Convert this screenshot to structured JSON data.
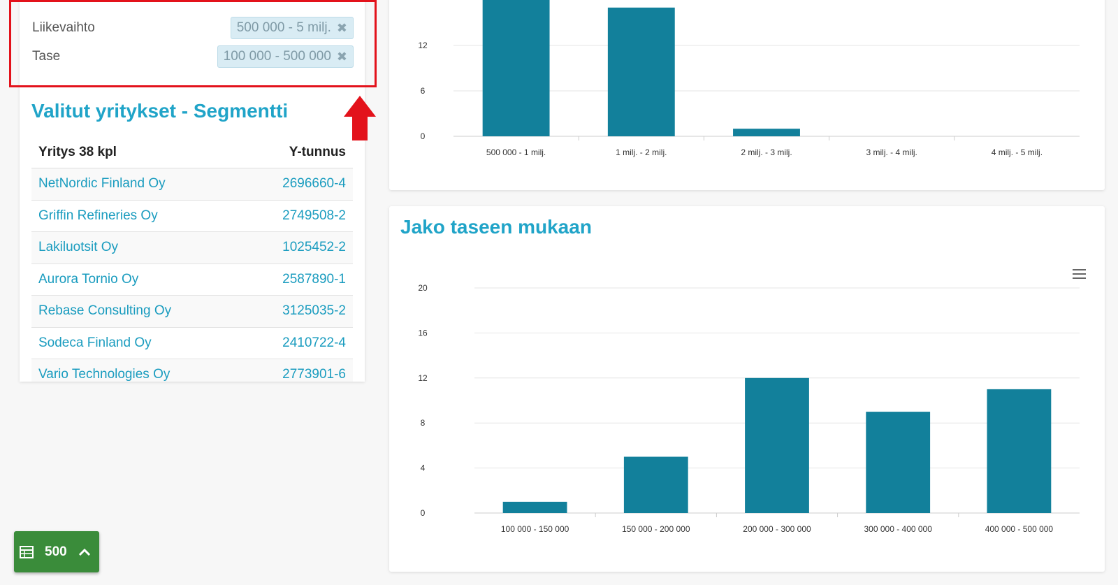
{
  "filters": {
    "items": [
      {
        "label": "Liikevaihto",
        "value": "500 000 - 5 milj."
      },
      {
        "label": "Tase",
        "value": "100 000 - 500 000"
      }
    ]
  },
  "section_title": "Valitut yritykset - Segmentti",
  "table": {
    "headers": {
      "company": "Yritys 38 kpl",
      "id": "Y-tunnus"
    },
    "rows": [
      {
        "name": "NetNordic Finland Oy",
        "id": "2696660-4"
      },
      {
        "name": "Griffin Refineries Oy",
        "id": "2749508-2"
      },
      {
        "name": "Lakiluotsit Oy",
        "id": "1025452-2"
      },
      {
        "name": "Aurora Tornio Oy",
        "id": "2587890-1"
      },
      {
        "name": "Rebase Consulting Oy",
        "id": "3125035-2"
      },
      {
        "name": "Sodeca Finland Oy",
        "id": "2410722-4"
      },
      {
        "name": "Vario Technologies Oy",
        "id": "2773901-6"
      }
    ]
  },
  "export_button": {
    "count": "500"
  },
  "colors": {
    "bar": "#12809b",
    "accent": "#20a4c8",
    "highlight": "#e3121b"
  },
  "chart_data": [
    {
      "type": "bar",
      "title": "",
      "categories": [
        "500 000 - 1 milj.",
        "1 milj. - 2 milj.",
        "2 milj. - 3 milj.",
        "3 milj. - 4 milj.",
        "4 milj. - 5 milj."
      ],
      "values": [
        18,
        17,
        1,
        0,
        0
      ],
      "ylim": [
        0,
        18
      ],
      "yticks": [
        0,
        6,
        12
      ],
      "grid": true
    },
    {
      "type": "bar",
      "title": "Jako taseen mukaan",
      "categories": [
        "100 000 - 150 000",
        "150 000 - 200 000",
        "200 000 - 300 000",
        "300 000 - 400 000",
        "400 000 - 500 000"
      ],
      "values": [
        1,
        5,
        12,
        9,
        11
      ],
      "ylim": [
        0,
        20
      ],
      "yticks": [
        0,
        4,
        8,
        12,
        16,
        20
      ],
      "grid": true
    }
  ]
}
